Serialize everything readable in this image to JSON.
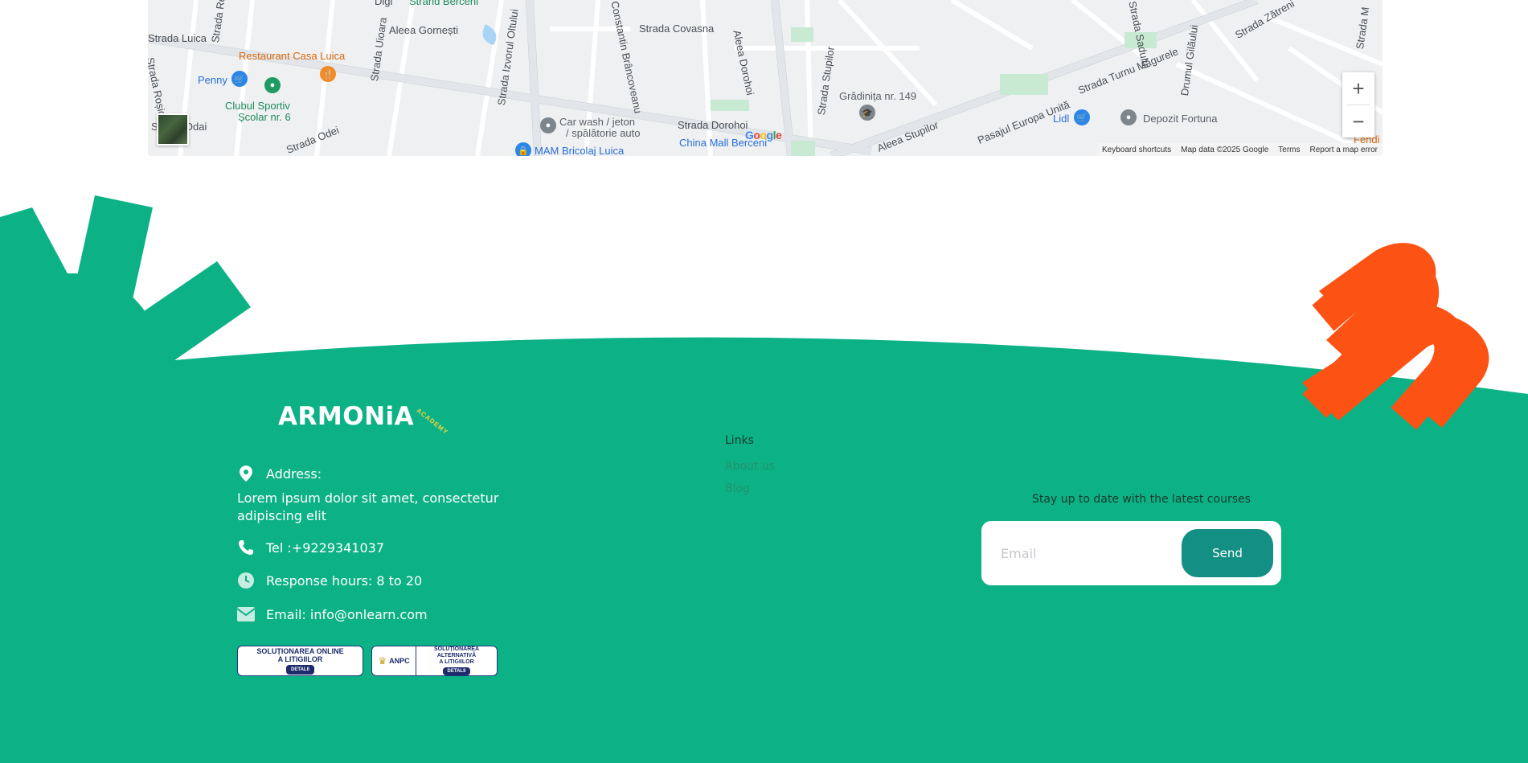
{
  "map": {
    "labels": {
      "strada_luica": "Strada Luica",
      "strada_odai": "Strada Odai",
      "strada_rosiori": "Strada Roșiori",
      "strada_res": "Strada Res",
      "restaurant": "Restaurant Casa Luica",
      "penny": "Penny",
      "clubul_1": "Clubul Sportiv",
      "clubul_2": "Școlar nr. 6",
      "strada_uioara": "Strada Uioara",
      "aleea_gornesti": "Aleea Gornești",
      "strand": "Strand Berceni",
      "strada_izvorul": "Strada Izvorul Oltului",
      "constantin": "Constantin Brâncoveanu",
      "covasna": "Strada Covasna",
      "aleea_dorohoi": "Aleea Dorohoi",
      "strada_stupilor": "Strada Stupilor",
      "gradinita": "Grădinița nr. 149",
      "carwash_1": "Car wash / jeton",
      "carwash_2": "/ spălătorie auto",
      "strada_dorohoi": "Strada Dorohoi",
      "china_mall": "China Mall Berceni",
      "mam": "MAM Bricolaj Luica",
      "aleea_stupilor": "Aleea Stupilor",
      "pasajul": "Pasajul Europa Unită",
      "turnu": "Strada Turnu Măgurele",
      "lidl": "Lidl",
      "depozit": "Depozit Fortuna",
      "drumul": "Drumul Gilăului",
      "zatreni": "Strada Zătreni",
      "sadului": "Strada Sadului",
      "fendi": "Fendi K",
      "strada_m": "Strada M",
      "strada_odei": "Strada Odei",
      "digi": "Digi"
    },
    "attribution": {
      "shortcuts": "Keyboard shortcuts",
      "mapdata": "Map data ©2025 Google",
      "terms": "Terms",
      "report": "Report a map error"
    },
    "google": "Google"
  },
  "footer": {
    "logo": "ARMONiA",
    "logo_sub": "ACADEMY",
    "address_label": "Address:",
    "address_line1": "Lorem ipsum dolor sit amet, consectetur",
    "address_line2": "adipiscing elit",
    "tel": "Tel :+9229341037",
    "hours": "Response hours: 8 to 20",
    "email": "Email: info@onlearn.com",
    "badge1_line1": "SOLUȚIONAREA ONLINE",
    "badge1_line2": "A LITIGIILOR",
    "badge1_btn": "DETALII",
    "badge2_org": "ANPC",
    "badge2_line1": "SOLUȚIONAREA ALTERNATIVĂ",
    "badge2_line2": "A LITIGIILOR",
    "badge2_btn": "DETALII",
    "links_title": "Links",
    "links": [
      "About us",
      "Blog"
    ],
    "newsletter_title": "Stay up to date with the latest courses",
    "email_placeholder": "Email",
    "send_label": "Send"
  },
  "colors": {
    "green": "#0cb286",
    "orange": "#fc5314",
    "button": "#148f84"
  }
}
